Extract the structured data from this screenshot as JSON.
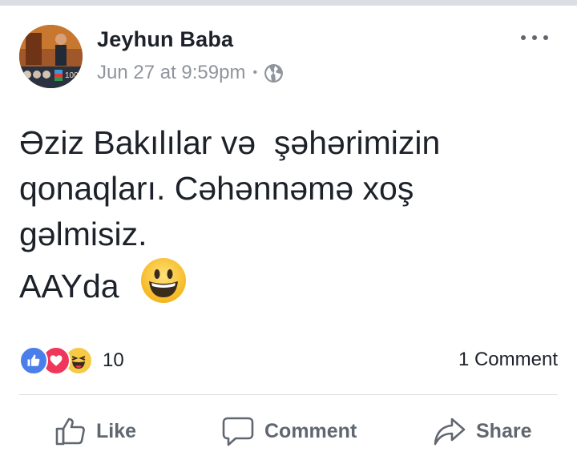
{
  "post": {
    "author": "Jeyhun Baba",
    "timestamp": "Jun 27 at 9:59pm",
    "meta_separator": "•",
    "privacy_icon": "globe-icon",
    "text_lines": [
      "Əziz Bakılılar və  şəhərimizin",
      "qonaqları. Cəhənnəmə xoş",
      "gəlmisiz.",
      "AAYda"
    ],
    "emoji": "grinning-face"
  },
  "avatar": {
    "badge_text": "100"
  },
  "reactions": {
    "types": [
      "like",
      "love",
      "haha"
    ],
    "count": "10"
  },
  "comments": {
    "count_label": "1 Comment"
  },
  "actions": {
    "like": "Like",
    "comment": "Comment",
    "share": "Share"
  },
  "colors": {
    "icon_gray": "#606770",
    "meta_gray": "#90949c",
    "like_blue": "#4a7eea",
    "love_red": "#f0365a",
    "haha_yellow": "#f7c945"
  }
}
